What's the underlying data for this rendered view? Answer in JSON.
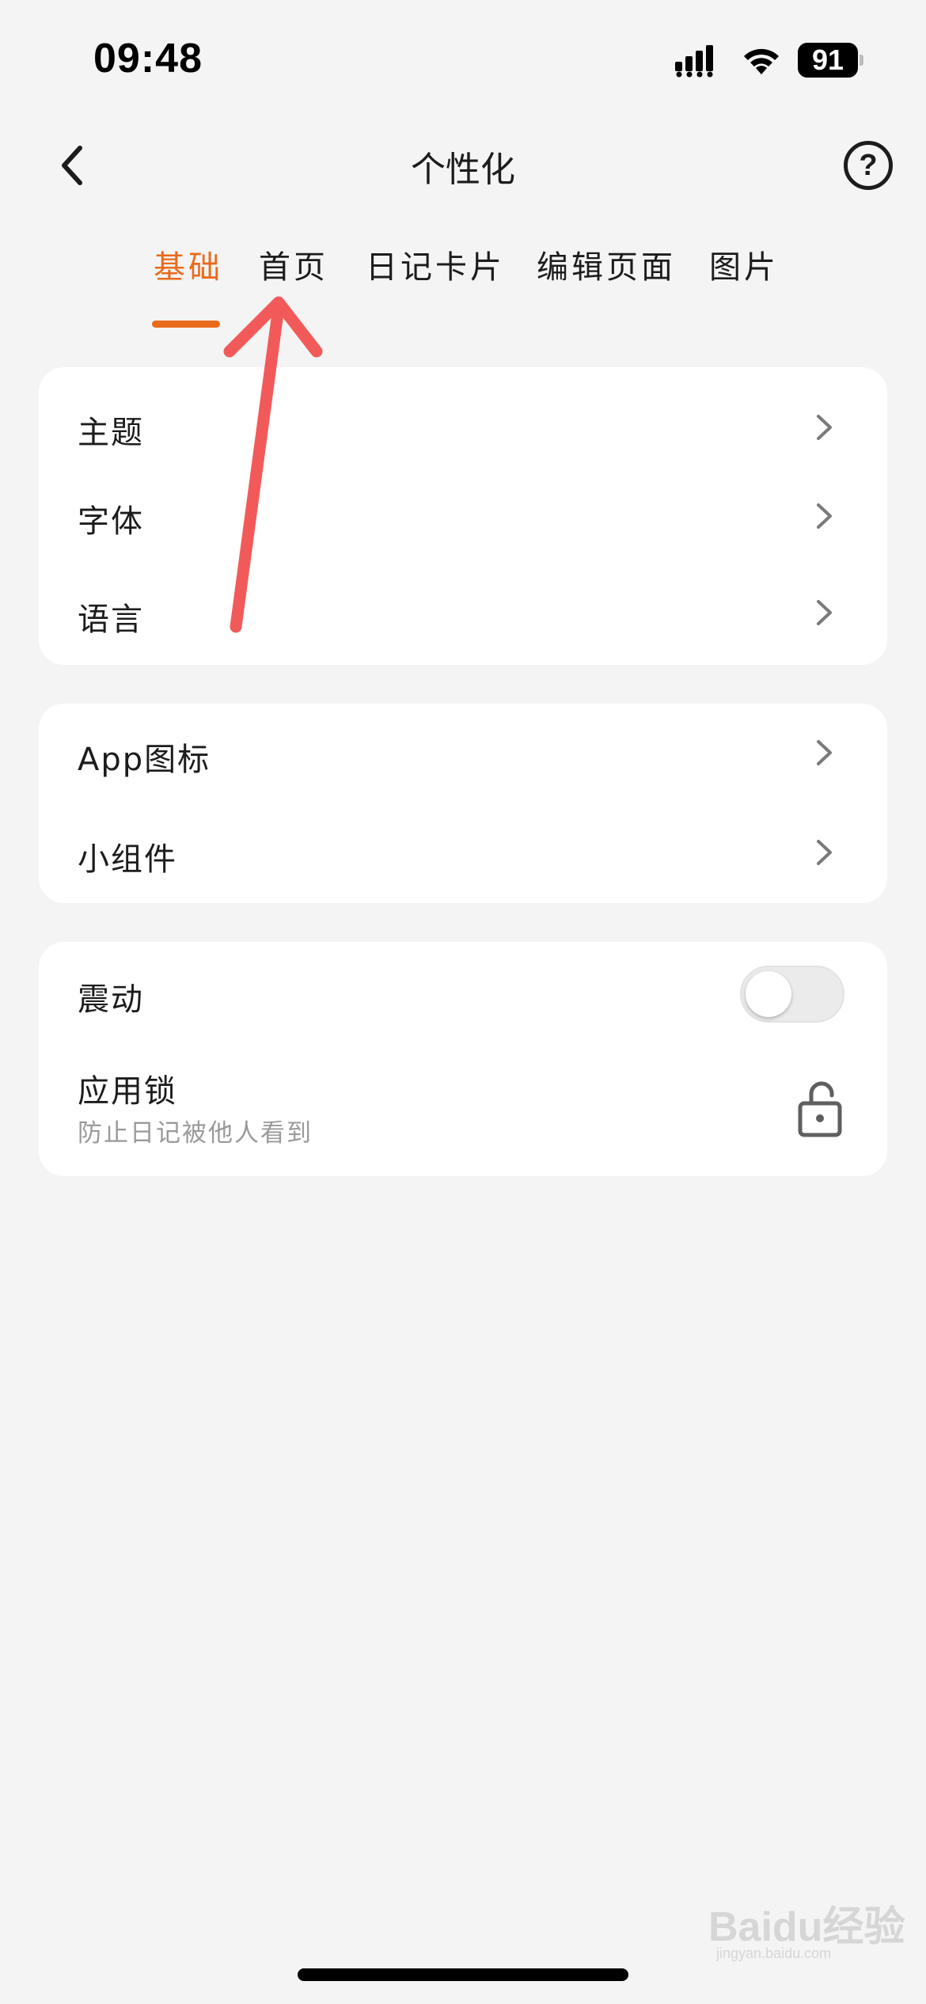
{
  "status_bar": {
    "time": "09:48",
    "battery": "91"
  },
  "nav": {
    "title": "个性化",
    "help_label": "?"
  },
  "tabs": [
    {
      "label": "基础",
      "active": true
    },
    {
      "label": "首页",
      "active": false
    },
    {
      "label": "日记卡片",
      "active": false
    },
    {
      "label": "编辑页面",
      "active": false
    },
    {
      "label": "图片",
      "active": false
    }
  ],
  "card1": {
    "items": [
      {
        "label": "主题"
      },
      {
        "label": "字体"
      },
      {
        "label": "语言"
      }
    ]
  },
  "card2": {
    "items": [
      {
        "label": "App图标"
      },
      {
        "label": "小组件"
      }
    ]
  },
  "card3": {
    "vibration": {
      "label": "震动",
      "enabled": false
    },
    "app_lock": {
      "label": "应用锁",
      "subtitle": "防止日记被他人看到"
    }
  },
  "watermark": {
    "brand": "Baidu经验",
    "url": "jingyan.baidu.com"
  },
  "colors": {
    "accent": "#ea6a1c",
    "background": "#f4f4f4",
    "card": "#ffffff",
    "annotation": "#f25a5a"
  }
}
